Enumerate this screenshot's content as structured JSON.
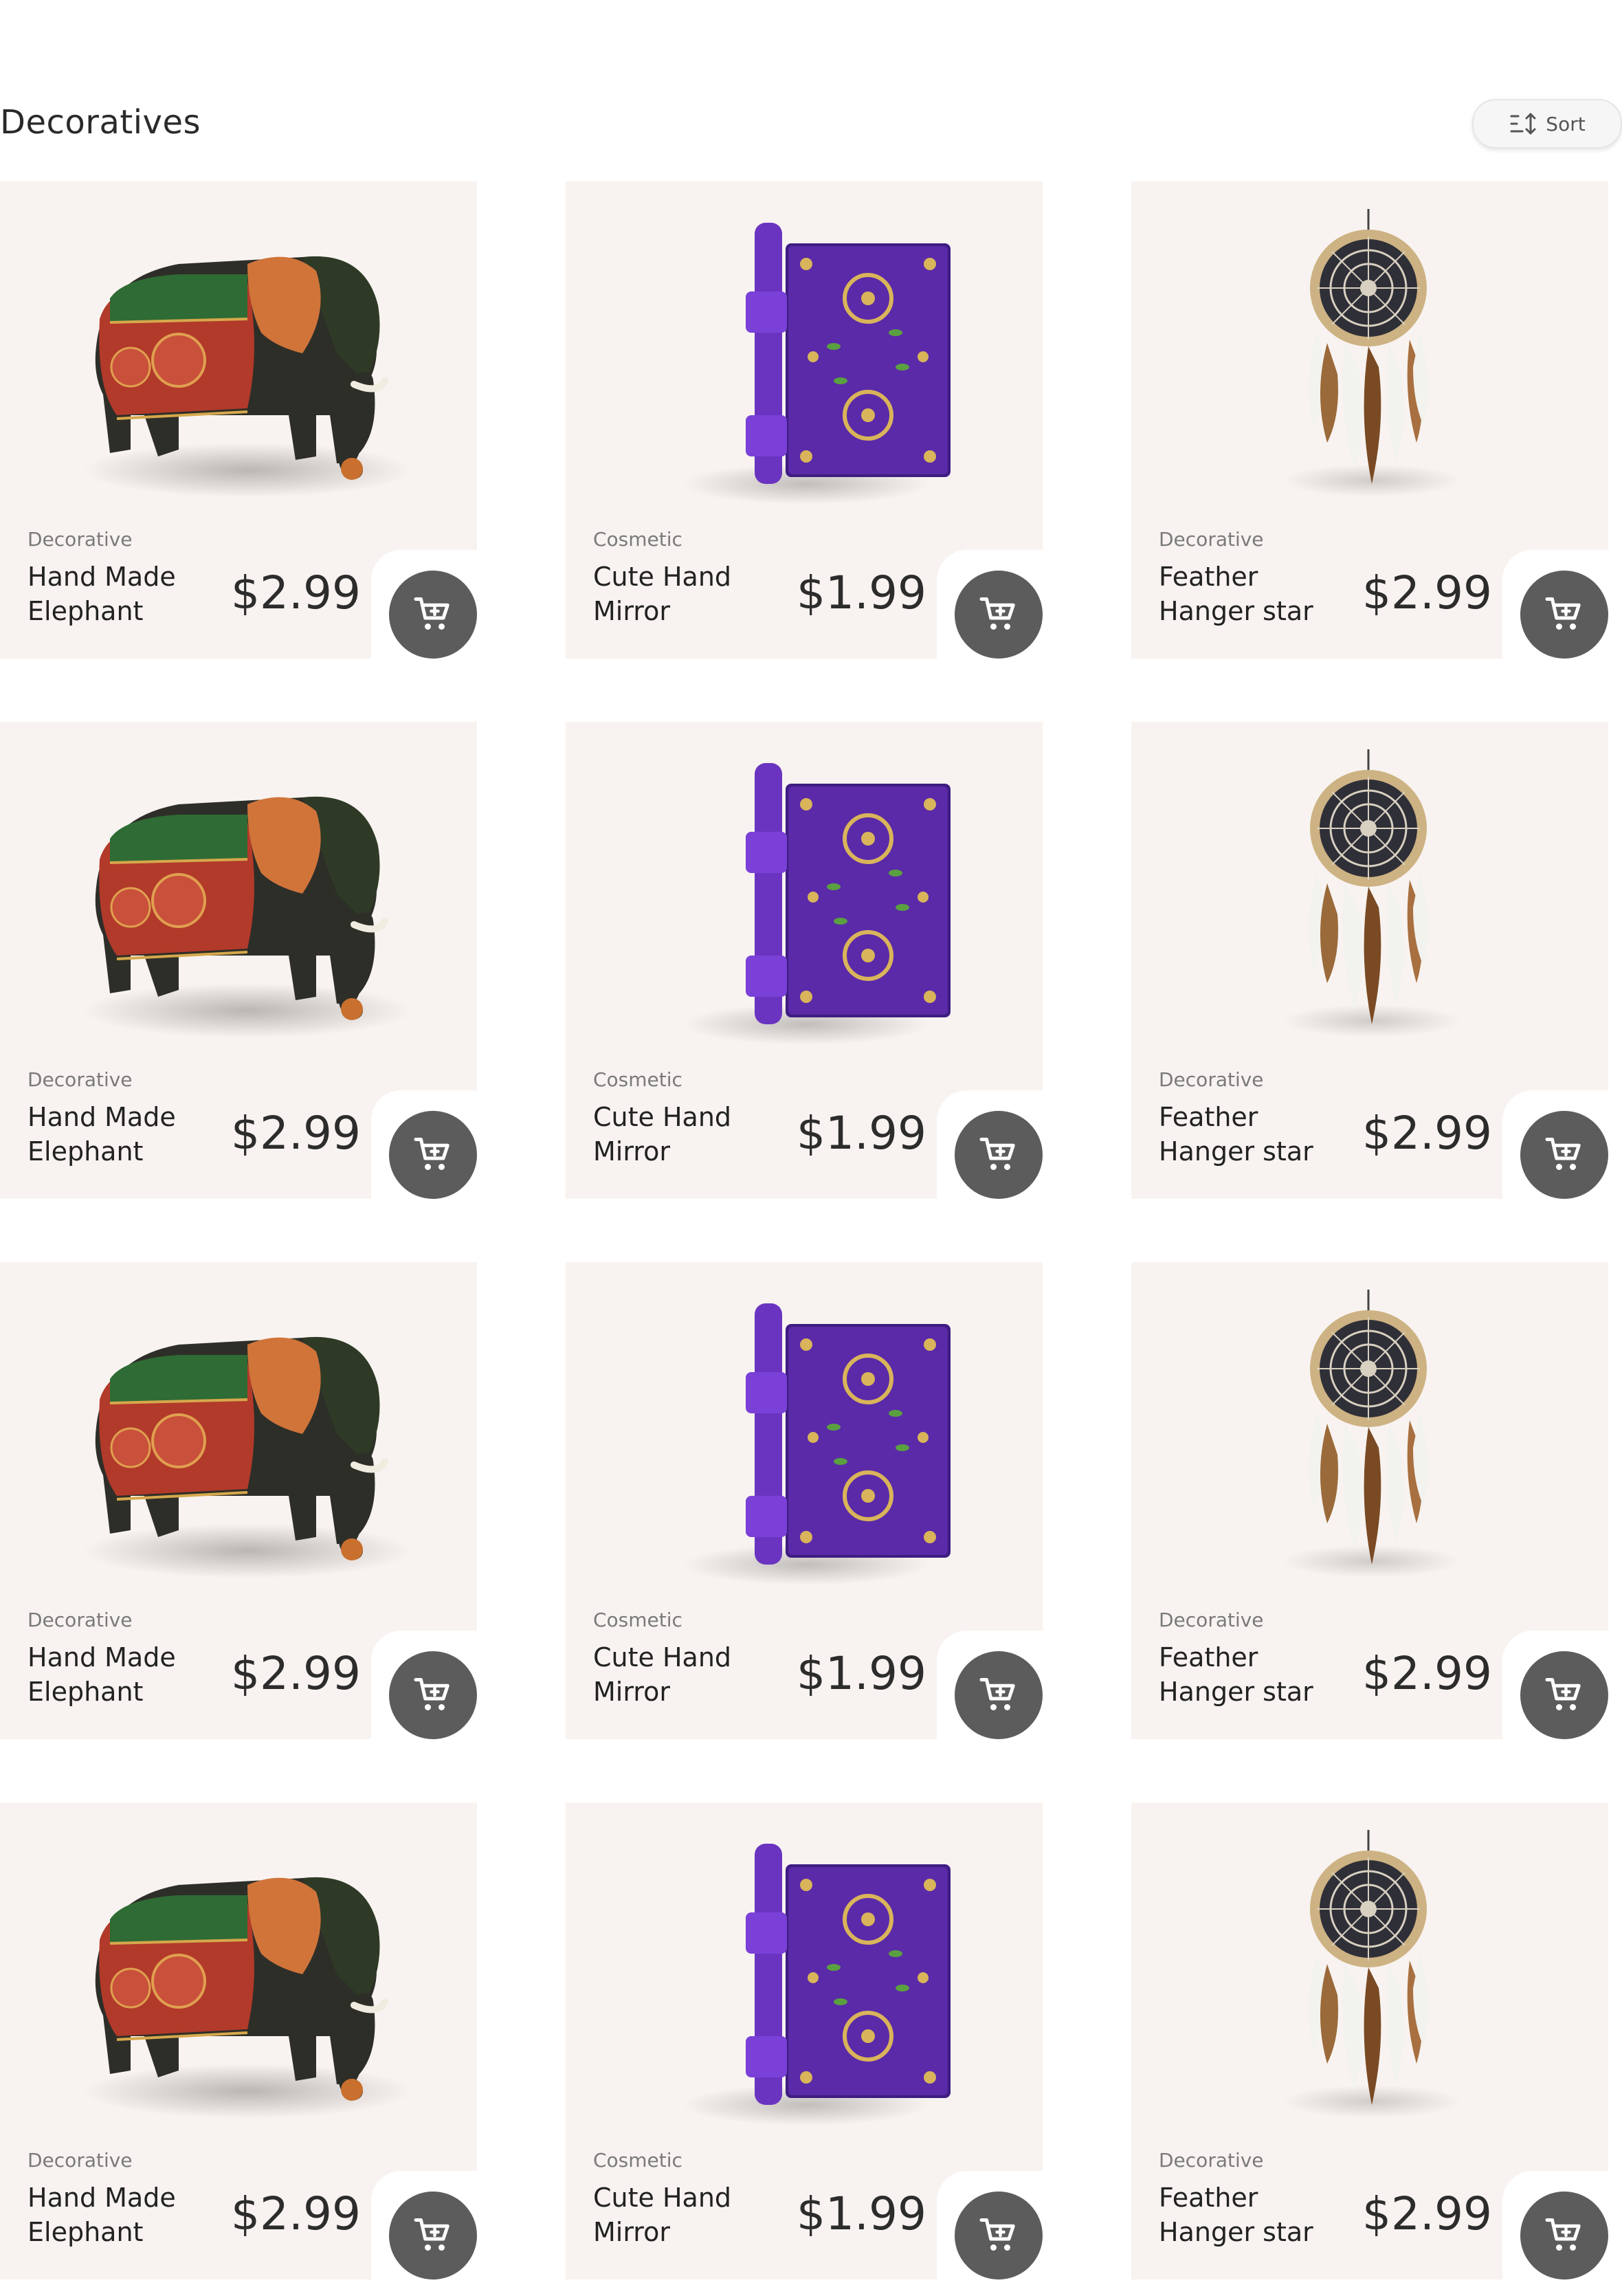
{
  "page": {
    "title": "Decoratives"
  },
  "sort": {
    "label": "Sort",
    "icon": "sort-icon"
  },
  "products": [
    {
      "category": "Decorative",
      "name": "Hand Made Elephant",
      "price": "$2.99",
      "image": "elephant-figurine",
      "cart_icon": "shopping-cart-icon"
    },
    {
      "category": "Cosmetic",
      "name": "Cute Hand Mirror",
      "price": "$1.99",
      "image": "purple-beaded-mirror",
      "cart_icon": "shopping-cart-icon"
    },
    {
      "category": "Decorative",
      "name": "Feather Hanger star",
      "price": "$2.99",
      "image": "dream-catcher",
      "cart_icon": "shopping-cart-icon"
    },
    {
      "category": "Decorative",
      "name": "Hand Made Elephant",
      "price": "$2.99",
      "image": "elephant-figurine",
      "cart_icon": "shopping-cart-icon"
    },
    {
      "category": "Cosmetic",
      "name": "Cute Hand Mirror",
      "price": "$1.99",
      "image": "purple-beaded-mirror",
      "cart_icon": "shopping-cart-icon"
    },
    {
      "category": "Decorative",
      "name": "Feather Hanger star",
      "price": "$2.99",
      "image": "dream-catcher",
      "cart_icon": "shopping-cart-icon"
    },
    {
      "category": "Decorative",
      "name": "Hand Made Elephant",
      "price": "$2.99",
      "image": "elephant-figurine",
      "cart_icon": "shopping-cart-icon"
    },
    {
      "category": "Cosmetic",
      "name": "Cute Hand Mirror",
      "price": "$1.99",
      "image": "purple-beaded-mirror",
      "cart_icon": "shopping-cart-icon"
    },
    {
      "category": "Decorative",
      "name": "Feather Hanger star",
      "price": "$2.99",
      "image": "dream-catcher",
      "cart_icon": "shopping-cart-icon"
    },
    {
      "category": "Decorative",
      "name": "Hand Made Elephant",
      "price": "$2.99",
      "image": "elephant-figurine",
      "cart_icon": "shopping-cart-icon"
    },
    {
      "category": "Cosmetic",
      "name": "Cute Hand Mirror",
      "price": "$1.99",
      "image": "purple-beaded-mirror",
      "cart_icon": "shopping-cart-icon"
    },
    {
      "category": "Decorative",
      "name": "Feather Hanger star",
      "price": "$2.99",
      "image": "dream-catcher",
      "cart_icon": "shopping-cart-icon"
    }
  ],
  "colors": {
    "card_background": "#f8f3f0",
    "cart_button": "#5c5c5c",
    "text_primary": "#222222",
    "text_secondary": "#7a7a7a"
  }
}
